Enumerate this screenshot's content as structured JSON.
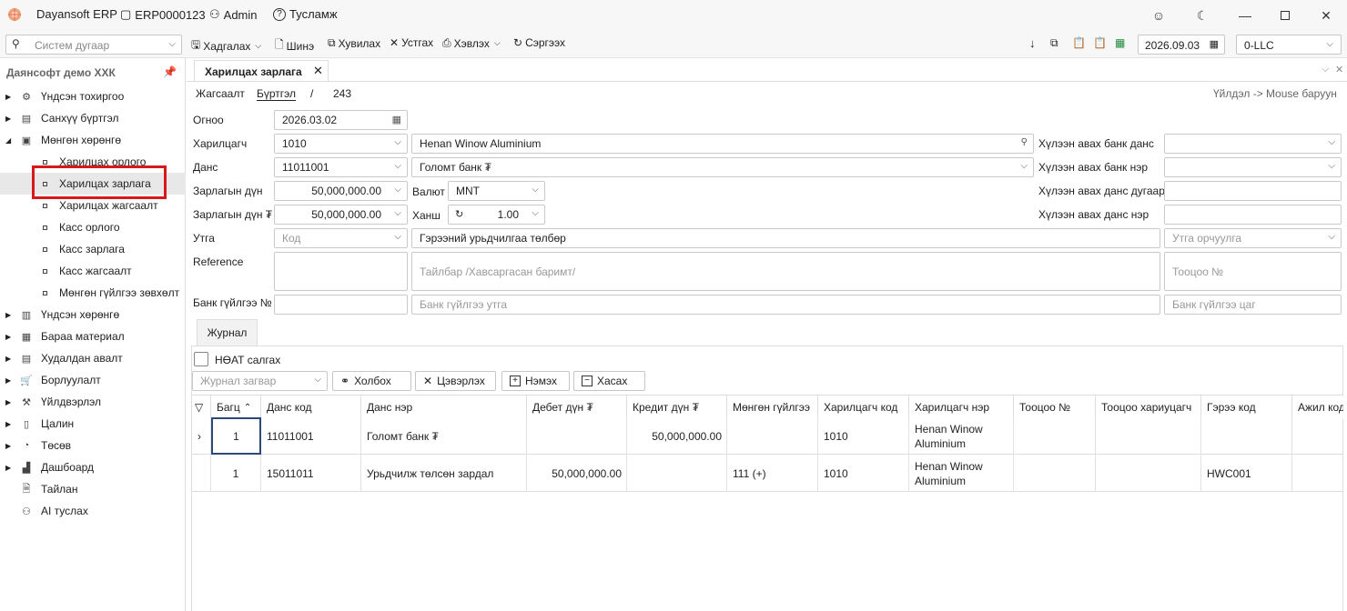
{
  "titlebar": {
    "app_name": "Dayansoft ERP",
    "db_name": "ERP0000123",
    "user": "Admin",
    "help": "Тусламж"
  },
  "toolbar": {
    "search_placeholder": "Систем дугаар",
    "save": "Хадгалах",
    "new": "Шинэ",
    "copy": "Хувилах",
    "delete": "Устгах",
    "print": "Хэвлэх",
    "refresh": "Сэргээх",
    "date": "2026.09.03",
    "company": "0-LLC"
  },
  "sidebar": {
    "company": "Даянсофт демо ХХК",
    "items": [
      {
        "label": "Үндсэн тохиргоо",
        "icon": "gear-icon"
      },
      {
        "label": "Санхүү бүртгэл",
        "icon": "ledger-icon"
      },
      {
        "label": "Мөнгөн хөрөнгө",
        "icon": "cash-icon"
      },
      {
        "label": "Үндсэн хөрөнгө",
        "icon": "building-icon"
      },
      {
        "label": "Бараа материал",
        "icon": "inventory-icon"
      },
      {
        "label": "Худалдан авалт",
        "icon": "purchase-icon"
      },
      {
        "label": "Борлуулалт",
        "icon": "cart-icon"
      },
      {
        "label": "Үйлдвэрлэл",
        "icon": "factory-icon"
      },
      {
        "label": "Цалин",
        "icon": "payroll-icon"
      },
      {
        "label": "Төсөв",
        "icon": "budget-icon"
      },
      {
        "label": "Дашбоард",
        "icon": "dashboard-icon"
      },
      {
        "label": "Тайлан",
        "icon": "report-icon"
      },
      {
        "label": "AI туслах",
        "icon": "ai-assistant-icon"
      }
    ],
    "subitems": [
      "Харилцах орлого",
      "Харилцах зарлага",
      "Харилцах жагсаалт",
      "Касс орлого",
      "Касс зарлага",
      "Касс жагсаалт",
      "Мөнгөн гүйлгээ зөвхөлт"
    ],
    "selected_subitem": "Харилцах зарлага"
  },
  "tab": {
    "title": "Харилцах зарлага"
  },
  "breadcrumb": {
    "list": "Жагсаалт",
    "register": "Бүртгэл",
    "sep": "/",
    "number": "243",
    "hint": "Үйлдэл -> Mouse баруун"
  },
  "form": {
    "date_label": "Огноо",
    "date": "2026.03.02",
    "partner_label": "Харилцагч",
    "partner_code": "1010",
    "partner_name": "Henan Winow Aluminium",
    "account_label": "Данс",
    "account_code": "11011001",
    "account_name": "Голомт банк ₮",
    "amount_label": "Зарлагын дүн",
    "amount": "50,000,000.00",
    "currency_label": "Валют",
    "currency": "MNT",
    "amount_mnt_label": "Зарлагын дүн ₮",
    "amount_mnt": "50,000,000.00",
    "rate_label": "Ханш",
    "rate": "1.00",
    "purpose_label": "Утга",
    "purpose_code_ph": "Код",
    "purpose_text": "Гэрээний урьдчилгаа төлбөр",
    "purpose_extra_ph": "Утга орчуулга",
    "reference_label": "Reference",
    "note_ph": "Тайлбар /Хавсаргасан баримт/",
    "calc_no_ph": "Тооцоо №",
    "bank_tx_label": "Банк гүйлгээ №",
    "bank_tx_text_ph": "Банк гүйлгээ утга",
    "bank_tx_time_ph": "Банк гүйлгээ цаг",
    "recv_bank_account_label": "Хүлээн авах банк данс",
    "recv_bank_name_label": "Хүлээн авах банк нэр",
    "recv_account_no_label": "Хүлээн авах данс дугаар",
    "recv_account_name_label": "Хүлээн авах данс нэр"
  },
  "journal": {
    "tab": "Журнал",
    "vat_label": "НӨАТ салгах",
    "template_ph": "Журнал загвар",
    "link": "Холбох",
    "clear": "Цэвэрлэх",
    "add": "Нэмэх",
    "remove": "Хасах",
    "columns": [
      "Багц",
      "Данс код",
      "Данс нэр",
      "Дебет дүн ₮",
      "Кредит дүн ₮",
      "Мөнгөн гүйлгээ",
      "Харилцагч код",
      "Харилцагч нэр",
      "Тооцоо №",
      "Тооцоо хариуцагч",
      "Гэрээ код",
      "Ажил код"
    ],
    "rows": [
      {
        "batch": "1",
        "account_code": "11011001",
        "account_name": "Голомт банк ₮",
        "debit": "",
        "credit": "50,000,000.00",
        "cashflow": "",
        "partner_code": "1010",
        "partner_name_1": "Henan Winow",
        "partner_name_2": "Aluminium",
        "calc_no": "",
        "calc_resp": "",
        "contract": ""
      },
      {
        "batch": "1",
        "account_code": "15011011",
        "account_name": "Урьдчилж төлсөн зардал",
        "debit": "50,000,000.00",
        "credit": "",
        "cashflow": "111 (+)",
        "partner_code": "1010",
        "partner_name_1": "Henan Winow",
        "partner_name_2": "Aluminium",
        "calc_no": "",
        "calc_resp": "",
        "contract": "HWC001"
      }
    ]
  },
  "colors": {
    "highlight_red": "#d7191c",
    "selected_bg": "#e8e8e8"
  }
}
